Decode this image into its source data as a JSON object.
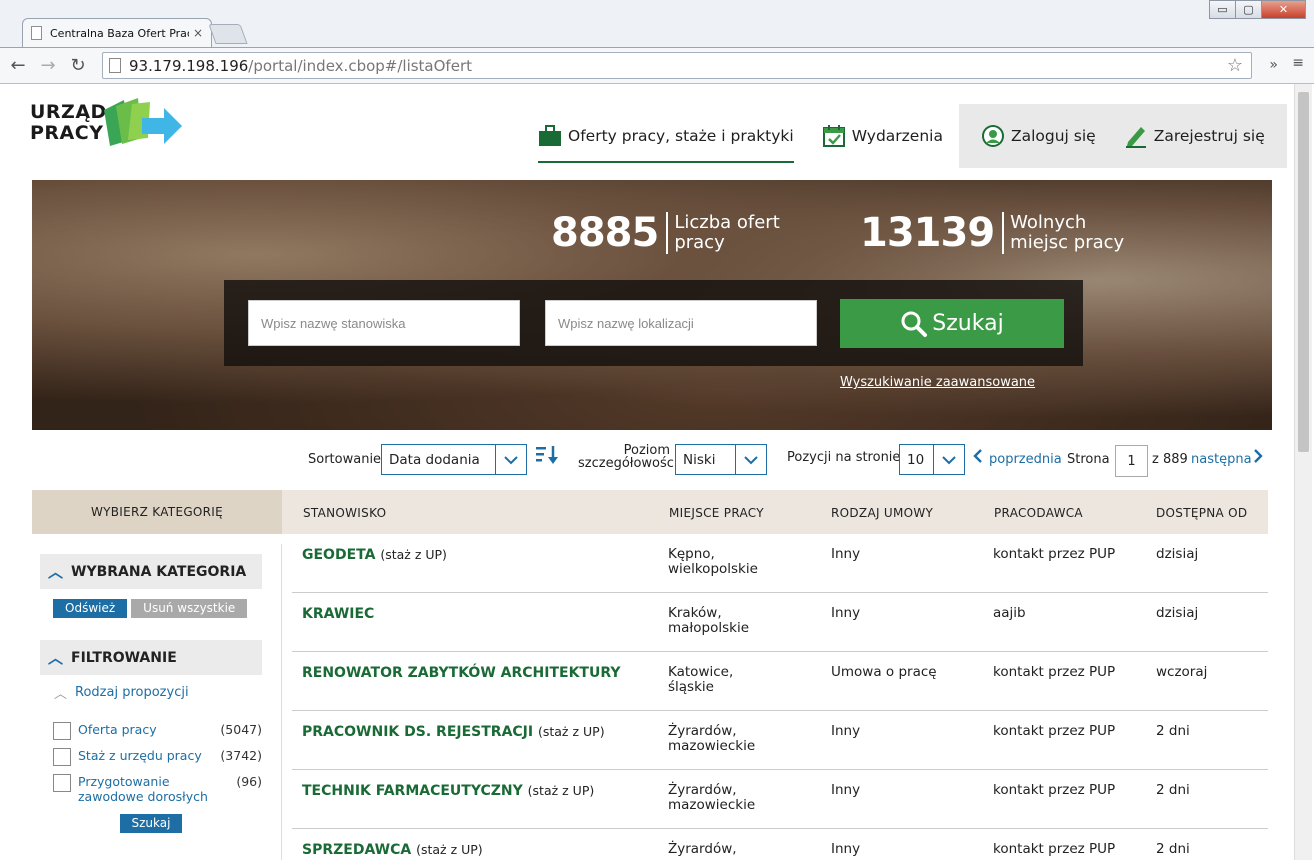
{
  "browser": {
    "tab_title": "Centralna Baza Ofert Prac",
    "tab_close": "×",
    "url_host": "93.179.198.196",
    "url_path": "/portal/index.cbop#/listaOfert",
    "win_minimize": "▭",
    "win_maximize": "▢",
    "win_close": "✕"
  },
  "logo": {
    "line1": "URZĄD",
    "line2": "PRACY"
  },
  "topnav": {
    "offers": "Oferty pracy, staże i praktyki",
    "events": "Wydarzenia",
    "login": "Zaloguj się",
    "register": "Zarejestruj się"
  },
  "hero": {
    "offers_count": "8885",
    "offers_label_1": "Liczba ofert",
    "offers_label_2": "pracy",
    "places_count": "13139",
    "places_label_1": "Wolnych",
    "places_label_2": "miejsc pracy",
    "position_placeholder": "Wpisz nazwę stanowiska",
    "location_placeholder": "Wpisz nazwę lokalizacji",
    "search_button": "Szukaj",
    "advanced_link": "Wyszukiwanie zaawansowane"
  },
  "sortbar": {
    "sort_label": "Sortowanie",
    "sort_value": "Data dodania",
    "detail_label_1": "Poziom",
    "detail_label_2": "szczegółowości",
    "detail_value": "Niski",
    "perpage_label": "Pozycji na stronie",
    "perpage_value": "10",
    "prev": "poprzednia",
    "page_label": "Strona",
    "page_value": "1",
    "page_total": "z 889",
    "next": "następna"
  },
  "table": {
    "category_header": "WYBIERZ KATEGORIĘ",
    "headers": [
      "STANOWISKO",
      "MIEJSCE PRACY",
      "RODZAJ UMOWY",
      "PRACODAWCA",
      "DOSTĘPNA OD"
    ],
    "rows": [
      {
        "title": "GEODETA",
        "note": "(staż z UP)",
        "place1": "Kępno,",
        "place2": "wielkopolskie",
        "contract": "Inny",
        "employer": "kontakt przez PUP",
        "available": "dzisiaj"
      },
      {
        "title": "KRAWIEC",
        "note": "",
        "place1": "Kraków,",
        "place2": "małopolskie",
        "contract": "Inny",
        "employer": "aajib",
        "available": "dzisiaj"
      },
      {
        "title": "RENOWATOR ZABYTKÓW ARCHITEKTURY",
        "note": "",
        "place1": "Katowice,",
        "place2": "śląskie",
        "contract": "Umowa o pracę",
        "employer": "kontakt przez PUP",
        "available": "wczoraj"
      },
      {
        "title": "PRACOWNIK DS. REJESTRACJI",
        "note": "(staż z UP)",
        "place1": "Żyrardów,",
        "place2": "mazowieckie",
        "contract": "Inny",
        "employer": "kontakt przez PUP",
        "available": "2 dni"
      },
      {
        "title": "TECHNIK FARMACEUTYCZNY",
        "note": "(staż z UP)",
        "place1": "Żyrardów,",
        "place2": "mazowieckie",
        "contract": "Inny",
        "employer": "kontakt przez PUP",
        "available": "2 dni"
      },
      {
        "title": "SPRZEDAWCA",
        "note": "(staż z UP)",
        "place1": "Żyrardów,",
        "place2": "",
        "contract": "Inny",
        "employer": "kontakt przez PUP",
        "available": "2 dni"
      }
    ]
  },
  "sidebar": {
    "selected_title": "WYBRANA KATEGORIA",
    "refresh": "Odśwież",
    "remove_all": "Usuń wszystkie",
    "filter_title": "FILTROWANIE",
    "group_label": "Rodzaj propozycji",
    "options": [
      {
        "label": "Oferta pracy",
        "count": "(5047)"
      },
      {
        "label": "Staż z urzędu pracy",
        "count": "(3742)"
      },
      {
        "label": "Przygotowanie zawodowe dorosłych",
        "count": "(96)"
      }
    ],
    "search_button": "Szukaj"
  },
  "colors": {
    "brand_green": "#1a6a36",
    "button_green": "#3b9a45",
    "link_blue": "#1c6ea4"
  }
}
